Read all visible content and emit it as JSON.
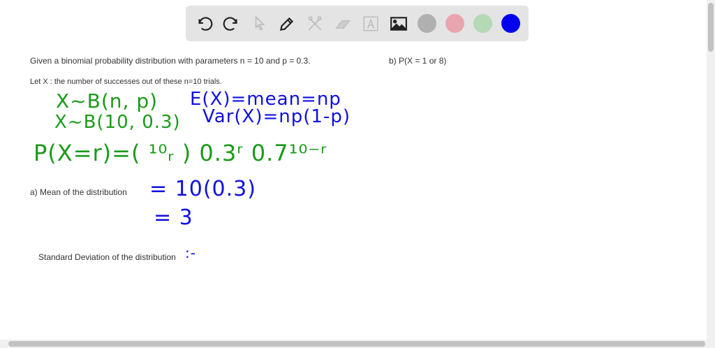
{
  "toolbar": {
    "tools": [
      "undo-icon",
      "redo-icon",
      "select-icon",
      "pen-icon",
      "tools-icon",
      "eraser-icon",
      "text-icon",
      "image-icon"
    ],
    "colors": [
      "#b0b0b0",
      "#e8a5b0",
      "#b5d8b5",
      "#0000ee"
    ]
  },
  "content": {
    "problem": "Given a binomial probability distribution with parameters n = 10 and p = 0.3.",
    "part_b": "b) P(X = 1 or 8)",
    "let_x": "Let X : the number of successes out of these n=10 trials.",
    "part_a": "a) Mean of the distribution",
    "std_label": "Standard Deviation of the distribution"
  },
  "handwriting": {
    "l1": "X~B(n, p)",
    "l2": "X~B(10, 0.3)",
    "l3": "P(X=r)=( ¹⁰ᵣ ) 0.3ʳ 0.7¹⁰⁻ʳ",
    "e": "E(X)=mean=np",
    "v": "Var(X)=np(1-p)",
    "m1": "= 10(0.3)",
    "m2": "= 3",
    "sd": ":-"
  }
}
